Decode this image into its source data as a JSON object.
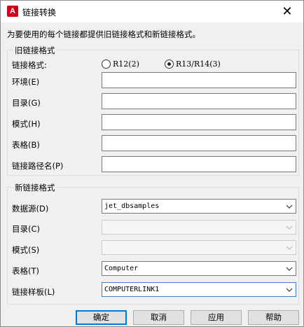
{
  "window": {
    "title": "链接转换",
    "app_icon_letter": "A",
    "close_glyph": "✕"
  },
  "description": "为要使用的每个链接都提供旧链接格式和新链接格式。",
  "old_format": {
    "group_title": "旧链接格式",
    "format_label": "链接格式:",
    "radio_r12": "R12(2)",
    "radio_r13": "R13/R14(3)",
    "selected": "R13/R14(3)",
    "environment_label": "环境(E)",
    "environment_value": "",
    "catalog_label": "目录(G)",
    "catalog_value": "",
    "schema_label": "模式(H)",
    "schema_value": "",
    "table_label": "表格(B)",
    "table_value": "",
    "path_label": "链接路径名(P)",
    "path_value": ""
  },
  "new_format": {
    "group_title": "新链接格式",
    "datasource_label": "数据源(D)",
    "datasource_value": "jet_dbsamples",
    "catalog_label": "目录(C)",
    "catalog_value": "",
    "schema_label": "模式(S)",
    "schema_value": "",
    "table_label": "表格(T)",
    "table_value": "Computer",
    "template_label": "链接样板(L)",
    "template_value": "COMPUTERLINK1"
  },
  "buttons": {
    "ok": "确定",
    "cancel": "取消",
    "apply": "应用",
    "help": "帮助"
  },
  "colors": {
    "app_icon": "#d0021b",
    "focus_border": "#0078d7"
  }
}
